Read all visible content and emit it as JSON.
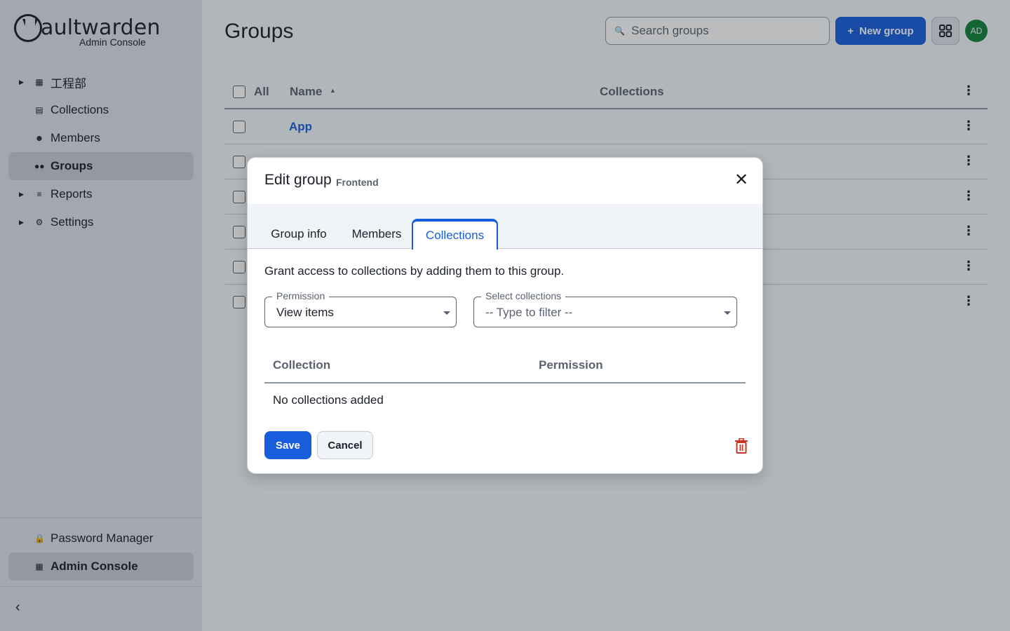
{
  "brand": {
    "word": "aultwarden",
    "subtitle": "Admin Console"
  },
  "sidebar": {
    "items": [
      {
        "label": "工程部",
        "icon": "building-icon",
        "expandable": true
      },
      {
        "label": "Collections",
        "icon": "collection-icon",
        "expandable": false
      },
      {
        "label": "Members",
        "icon": "user-icon",
        "expandable": false
      },
      {
        "label": "Groups",
        "icon": "users-icon",
        "expandable": false,
        "active": true
      },
      {
        "label": "Reports",
        "icon": "sliders-icon",
        "expandable": true
      },
      {
        "label": "Settings",
        "icon": "gear-icon",
        "expandable": true
      }
    ],
    "bottom": [
      {
        "label": "Password Manager",
        "icon": "lock-icon"
      },
      {
        "label": "Admin Console",
        "icon": "building-icon",
        "active": true
      }
    ]
  },
  "page": {
    "title": "Groups",
    "search_placeholder": "Search groups",
    "new_button": "New group",
    "avatar_initials": "AD"
  },
  "table": {
    "col_all": "All",
    "col_name": "Name",
    "col_collections": "Collections",
    "rows": [
      {
        "name": "App"
      },
      {
        "name": ""
      },
      {
        "name": ""
      },
      {
        "name": ""
      },
      {
        "name": ""
      },
      {
        "name": ""
      }
    ]
  },
  "dialog": {
    "title": "Edit group",
    "subtitle": "Frontend",
    "tabs": [
      "Group info",
      "Members",
      "Collections"
    ],
    "active_tab": "Collections",
    "description": "Grant access to collections by adding them to this group.",
    "permission_label": "Permission",
    "permission_value": "View items",
    "select_label": "Select collections",
    "select_placeholder": "-- Type to filter --",
    "col_collection": "Collection",
    "col_permission": "Permission",
    "empty_message": "No collections added",
    "save": "Save",
    "cancel": "Cancel"
  },
  "colors": {
    "primary": "#175ddc",
    "danger": "#c83522",
    "avatar": "#12823a"
  }
}
